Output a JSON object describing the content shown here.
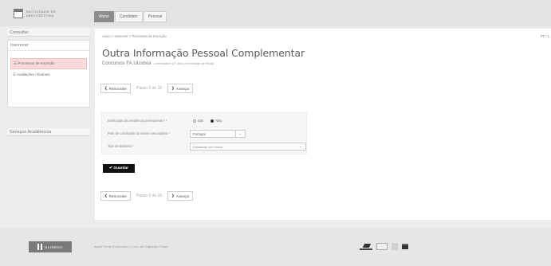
{
  "header": {
    "logo_text": "FACULDADE DE ARQUITETURA",
    "tabs": [
      "Aluno",
      "Candidato",
      "Pessoal"
    ]
  },
  "sidebar": {
    "consultar": "Consultar",
    "inscrever": "Inscrever",
    "items": [
      "☰ Processos de Inscrição",
      "☰ Avaliações / Exames"
    ],
    "servicos": "Serviços Académicos"
  },
  "content": {
    "breadcrumb": "Aluno  >  Inscrever  >  Processos de Inscrição",
    "lang": "PT / 1",
    "title": "Outra Informação Pessoal Complementar",
    "subtitle": "Concursos FA.ULisboa",
    "subtitle_small": "Licenciatura (1º ciclo) em Design de Moda",
    "prev_label": "Retroceder",
    "next_label": "Avançar",
    "step_label": "Passo 5 de 16"
  },
  "form": {
    "residencia_label": "Deslocado da residência permanente? *",
    "opt_sim": "Sim",
    "opt_nao": "Não",
    "pais_label": "País de conclusão do ensino secundário *",
    "pais_value": "Portugal",
    "bolseiro_label": "Tipo de Bolseiro *",
    "bolseiro_value": "Estudante sem bolsa"
  },
  "save_label": "✔ Guardar",
  "footer": {
    "ulisboa": "ULISBOA",
    "links": "Apoio Portal (Formulário)   |   Livro de Sugestão Portal"
  }
}
